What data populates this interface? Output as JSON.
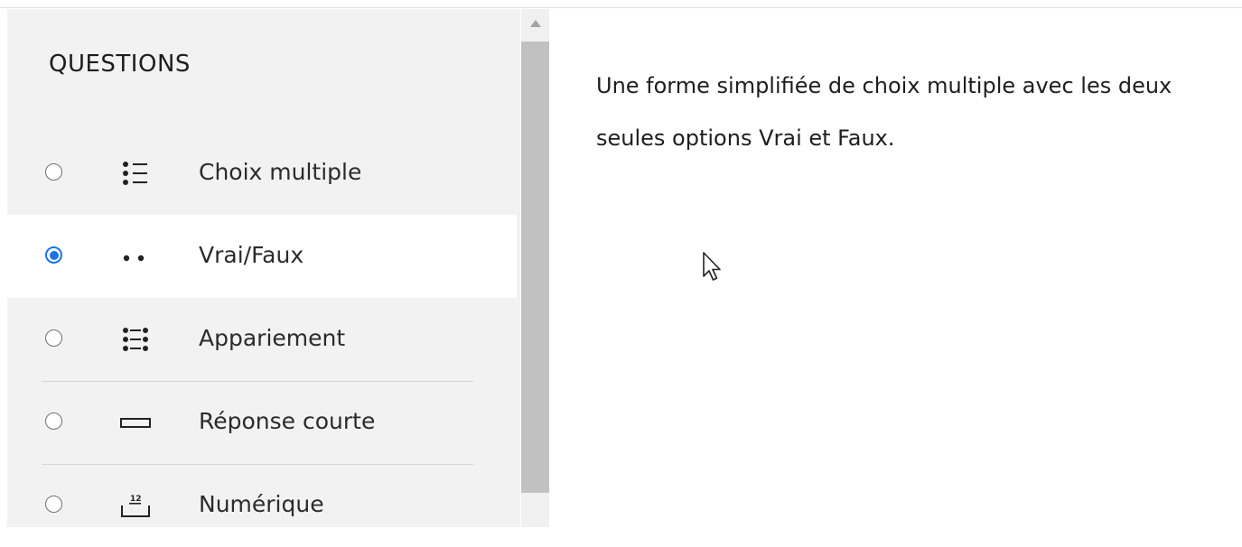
{
  "sidebar": {
    "title": "QUESTIONS",
    "items": [
      {
        "label": "Choix multiple",
        "icon": "list-icon",
        "selected": false
      },
      {
        "label": "Vrai/Faux",
        "icon": "two-dots-icon",
        "selected": true
      },
      {
        "label": "Appariement",
        "icon": "matching-icon",
        "selected": false
      },
      {
        "label": "Réponse courte",
        "icon": "short-answer-icon",
        "selected": false
      },
      {
        "label": "Numérique",
        "icon": "numeric-icon",
        "selected": false
      }
    ]
  },
  "description": {
    "text": "Une forme simplifiée de choix multiple avec les deux seules options Vrai et Faux."
  },
  "colors": {
    "accent": "#1a73e8",
    "panel_bg": "#f2f2f2",
    "selected_bg": "#ffffff"
  }
}
